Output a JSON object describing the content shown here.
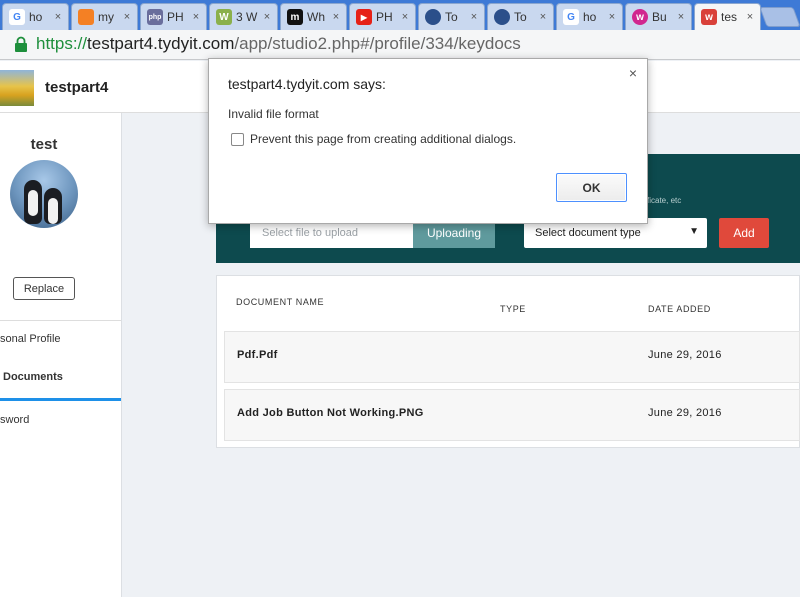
{
  "tabs": [
    {
      "title": "ho",
      "icon": "google-icon"
    },
    {
      "title": "my",
      "icon": "stackoverflow-icon"
    },
    {
      "title": "PH",
      "icon": "php-icon"
    },
    {
      "title": "3 W",
      "icon": "wikihow-icon"
    },
    {
      "title": "Wh",
      "icon": "m-icon"
    },
    {
      "title": "PH",
      "icon": "youtube-icon"
    },
    {
      "title": "To",
      "icon": "globe-icon"
    },
    {
      "title": "To",
      "icon": "globe-icon"
    },
    {
      "title": "ho",
      "icon": "google-icon"
    },
    {
      "title": "Bu",
      "icon": "wix-icon"
    },
    {
      "title": "tes",
      "icon": "tydy-icon"
    }
  ],
  "tab_close": "×",
  "url": {
    "proto": "https://",
    "host": "testpart4.tydyit.com",
    "path": "/app/studio2.php#/profile/334/keydocs"
  },
  "header": {
    "brand": "testpart4"
  },
  "sidebar": {
    "username": "test",
    "replace_label": "Replace",
    "items": [
      {
        "label": "sonal Profile"
      },
      {
        "label": "Documents"
      },
      {
        "label": "sword"
      }
    ]
  },
  "upload": {
    "hint": "ficate, etc",
    "file_placeholder": "Select file to upload",
    "upload_label": "Uploading",
    "doctype_selected": "Select document type",
    "add_label": "Add"
  },
  "table": {
    "headers": {
      "name": "DOCUMENT NAME",
      "type": "TYPE",
      "date": "DATE ADDED"
    },
    "rows": [
      {
        "name": "Pdf.Pdf",
        "type": "",
        "date": "June 29, 2016"
      },
      {
        "name": "Add Job Button Not Working.PNG",
        "type": "",
        "date": "June 29, 2016"
      }
    ]
  },
  "dialog": {
    "title": "testpart4.tydyit.com says:",
    "message": "Invalid file format",
    "checkbox_label": "Prevent this page from creating additional dialogs.",
    "ok_label": "OK",
    "close": "×"
  },
  "colors": {
    "tabstrip": "#3e7ad6",
    "band": "#0d4a4e",
    "upload_btn": "#5f9a9d",
    "add_btn": "#e0493b",
    "active_bar": "#1e90e8"
  }
}
